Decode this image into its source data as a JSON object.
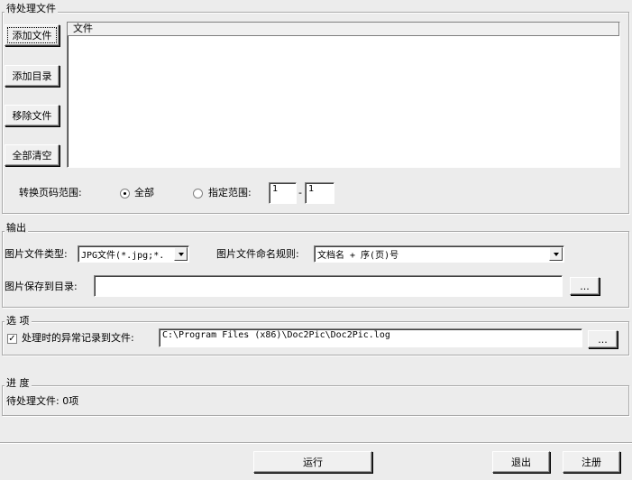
{
  "pending": {
    "title": "待处理文件",
    "buttons": {
      "add_file": "添加文件",
      "add_dir": "添加目录",
      "remove_file": "移除文件",
      "clear_all": "全部清空"
    },
    "list_header": "文件",
    "range_label": "转换页码范围:",
    "radio_all": "全部",
    "radio_specify": "指定范围:",
    "range_from": "1",
    "range_to": "1",
    "range_dash": "-"
  },
  "output": {
    "title": "输出",
    "type_label": "图片文件类型:",
    "type_value": "JPG文件(*.jpg;*.",
    "naming_label": "图片文件命名规则:",
    "naming_value": "文档名 + 序(页)号",
    "save_label": "图片保存到目录:",
    "save_value": "",
    "browse": "..."
  },
  "options": {
    "title": "选 项",
    "log_checkbox_label": "处理时的异常记录到文件:",
    "log_checked": true,
    "log_path": "C:\\Program Files (x86)\\Doc2Pic\\Doc2Pic.log",
    "browse": "..."
  },
  "progress": {
    "title": "进 度",
    "status": "待处理文件: 0项"
  },
  "footer": {
    "run": "运行",
    "exit": "退出",
    "register": "注册"
  }
}
